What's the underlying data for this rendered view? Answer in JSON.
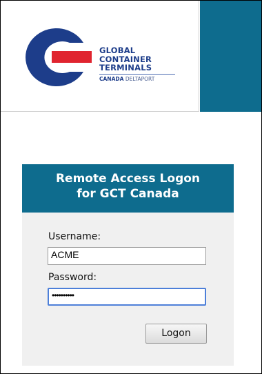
{
  "brand": {
    "line1": "GLOBAL",
    "line2": "CONTAINER",
    "line3": "TERMINALS",
    "sub_bold": "CANADA",
    "sub_light": "DELTAPORT"
  },
  "login": {
    "title_line1": "Remote Access Logon",
    "title_line2": "for GCT Canada",
    "username_label": "Username:",
    "username_value": "ACME",
    "password_label": "Password:",
    "password_value": "••••••••••",
    "logon_label": "Logon"
  },
  "colors": {
    "accent_teal": "#0e6c8e",
    "logo_blue": "#1d3d8a",
    "logo_red": "#e0242f",
    "panel_bg": "#f0f0f0"
  }
}
